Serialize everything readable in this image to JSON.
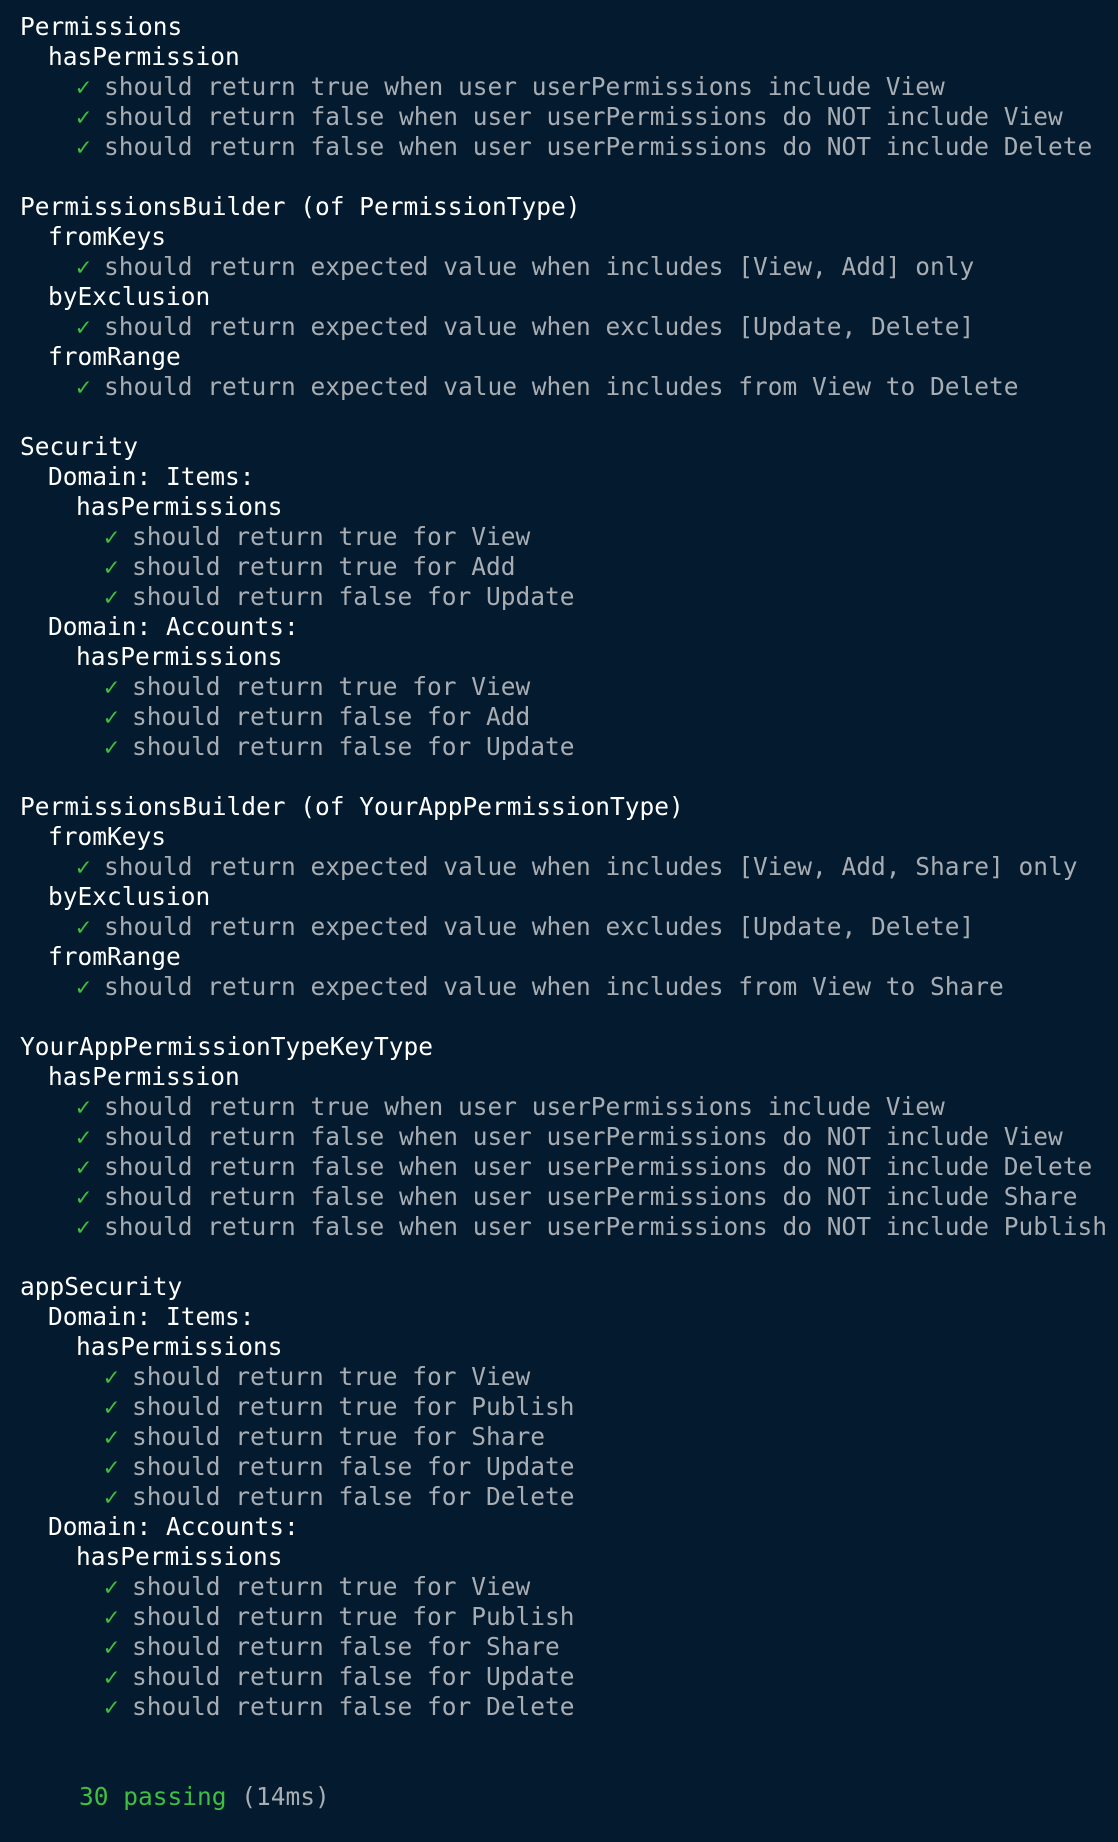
{
  "check_glyph": "✓",
  "colors": {
    "background": "#041a2e",
    "suite_text": "#ffffff",
    "test_text": "#a7adb3",
    "pass_green": "#3fbf3f"
  },
  "report": [
    {
      "type": "suite",
      "level": 1,
      "text": "Permissions"
    },
    {
      "type": "suite",
      "level": 2,
      "text": "hasPermission"
    },
    {
      "type": "test",
      "level": 3,
      "text": "should return true when user userPermissions include View"
    },
    {
      "type": "test",
      "level": 3,
      "text": "should return false when user userPermissions do NOT include View"
    },
    {
      "type": "test",
      "level": 3,
      "text": "should return false when user userPermissions do NOT include Delete"
    },
    {
      "type": "blank"
    },
    {
      "type": "suite",
      "level": 1,
      "text": "PermissionsBuilder (of PermissionType)"
    },
    {
      "type": "suite",
      "level": 2,
      "text": "fromKeys"
    },
    {
      "type": "test",
      "level": 3,
      "text": "should return expected value when includes [View, Add] only"
    },
    {
      "type": "suite",
      "level": 2,
      "text": "byExclusion"
    },
    {
      "type": "test",
      "level": 3,
      "text": "should return expected value when excludes [Update, Delete]"
    },
    {
      "type": "suite",
      "level": 2,
      "text": "fromRange"
    },
    {
      "type": "test",
      "level": 3,
      "text": "should return expected value when includes from View to Delete"
    },
    {
      "type": "blank"
    },
    {
      "type": "suite",
      "level": 1,
      "text": "Security"
    },
    {
      "type": "suite",
      "level": 2,
      "text": "Domain: Items:"
    },
    {
      "type": "suite",
      "level": 3,
      "text": "hasPermissions"
    },
    {
      "type": "test",
      "level": 4,
      "text": "should return true for View"
    },
    {
      "type": "test",
      "level": 4,
      "text": "should return true for Add"
    },
    {
      "type": "test",
      "level": 4,
      "text": "should return false for Update"
    },
    {
      "type": "suite",
      "level": 2,
      "text": "Domain: Accounts:"
    },
    {
      "type": "suite",
      "level": 3,
      "text": "hasPermissions"
    },
    {
      "type": "test",
      "level": 4,
      "text": "should return true for View"
    },
    {
      "type": "test",
      "level": 4,
      "text": "should return false for Add"
    },
    {
      "type": "test",
      "level": 4,
      "text": "should return false for Update"
    },
    {
      "type": "blank"
    },
    {
      "type": "suite",
      "level": 1,
      "text": "PermissionsBuilder (of YourAppPermissionType)"
    },
    {
      "type": "suite",
      "level": 2,
      "text": "fromKeys"
    },
    {
      "type": "test",
      "level": 3,
      "text": "should return expected value when includes [View, Add, Share] only"
    },
    {
      "type": "suite",
      "level": 2,
      "text": "byExclusion"
    },
    {
      "type": "test",
      "level": 3,
      "text": "should return expected value when excludes [Update, Delete]"
    },
    {
      "type": "suite",
      "level": 2,
      "text": "fromRange"
    },
    {
      "type": "test",
      "level": 3,
      "text": "should return expected value when includes from View to Share"
    },
    {
      "type": "blank"
    },
    {
      "type": "suite",
      "level": 1,
      "text": "YourAppPermissionTypeKeyType"
    },
    {
      "type": "suite",
      "level": 2,
      "text": "hasPermission"
    },
    {
      "type": "test",
      "level": 3,
      "text": "should return true when user userPermissions include View"
    },
    {
      "type": "test",
      "level": 3,
      "text": "should return false when user userPermissions do NOT include View"
    },
    {
      "type": "test",
      "level": 3,
      "text": "should return false when user userPermissions do NOT include Delete"
    },
    {
      "type": "test",
      "level": 3,
      "text": "should return false when user userPermissions do NOT include Share"
    },
    {
      "type": "test",
      "level": 3,
      "text": "should return false when user userPermissions do NOT include Publish"
    },
    {
      "type": "blank"
    },
    {
      "type": "suite",
      "level": 1,
      "text": "appSecurity"
    },
    {
      "type": "suite",
      "level": 2,
      "text": "Domain: Items:"
    },
    {
      "type": "suite",
      "level": 3,
      "text": "hasPermissions"
    },
    {
      "type": "test",
      "level": 4,
      "text": "should return true for View"
    },
    {
      "type": "test",
      "level": 4,
      "text": "should return true for Publish"
    },
    {
      "type": "test",
      "level": 4,
      "text": "should return true for Share"
    },
    {
      "type": "test",
      "level": 4,
      "text": "should return false for Update"
    },
    {
      "type": "test",
      "level": 4,
      "text": "should return false for Delete"
    },
    {
      "type": "suite",
      "level": 2,
      "text": "Domain: Accounts:"
    },
    {
      "type": "suite",
      "level": 3,
      "text": "hasPermissions"
    },
    {
      "type": "test",
      "level": 4,
      "text": "should return true for View"
    },
    {
      "type": "test",
      "level": 4,
      "text": "should return true for Publish"
    },
    {
      "type": "test",
      "level": 4,
      "text": "should return false for Share"
    },
    {
      "type": "test",
      "level": 4,
      "text": "should return false for Update"
    },
    {
      "type": "test",
      "level": 4,
      "text": "should return false for Delete"
    }
  ],
  "summary": {
    "passing": "30 passing",
    "duration": "(14ms)"
  }
}
